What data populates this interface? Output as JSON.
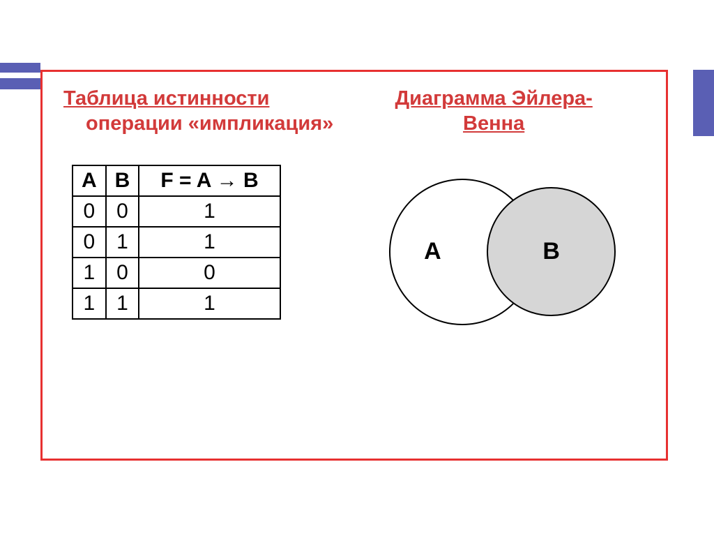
{
  "left": {
    "heading_line1": "Таблица истинности",
    "heading_line2": "операции «импликация»"
  },
  "right": {
    "heading_line1": "Диаграмма Эйлера-",
    "heading_line2": "Венна"
  },
  "table": {
    "headers": {
      "a": "A",
      "b": "B",
      "f": "F = A → B"
    },
    "rows": [
      {
        "a": "0",
        "b": "0",
        "f": "1"
      },
      {
        "a": "0",
        "b": "1",
        "f": "1"
      },
      {
        "a": "1",
        "b": "0",
        "f": "0"
      },
      {
        "a": "1",
        "b": "1",
        "f": "1"
      }
    ]
  },
  "venn": {
    "label_a": "А",
    "label_b": "В"
  }
}
